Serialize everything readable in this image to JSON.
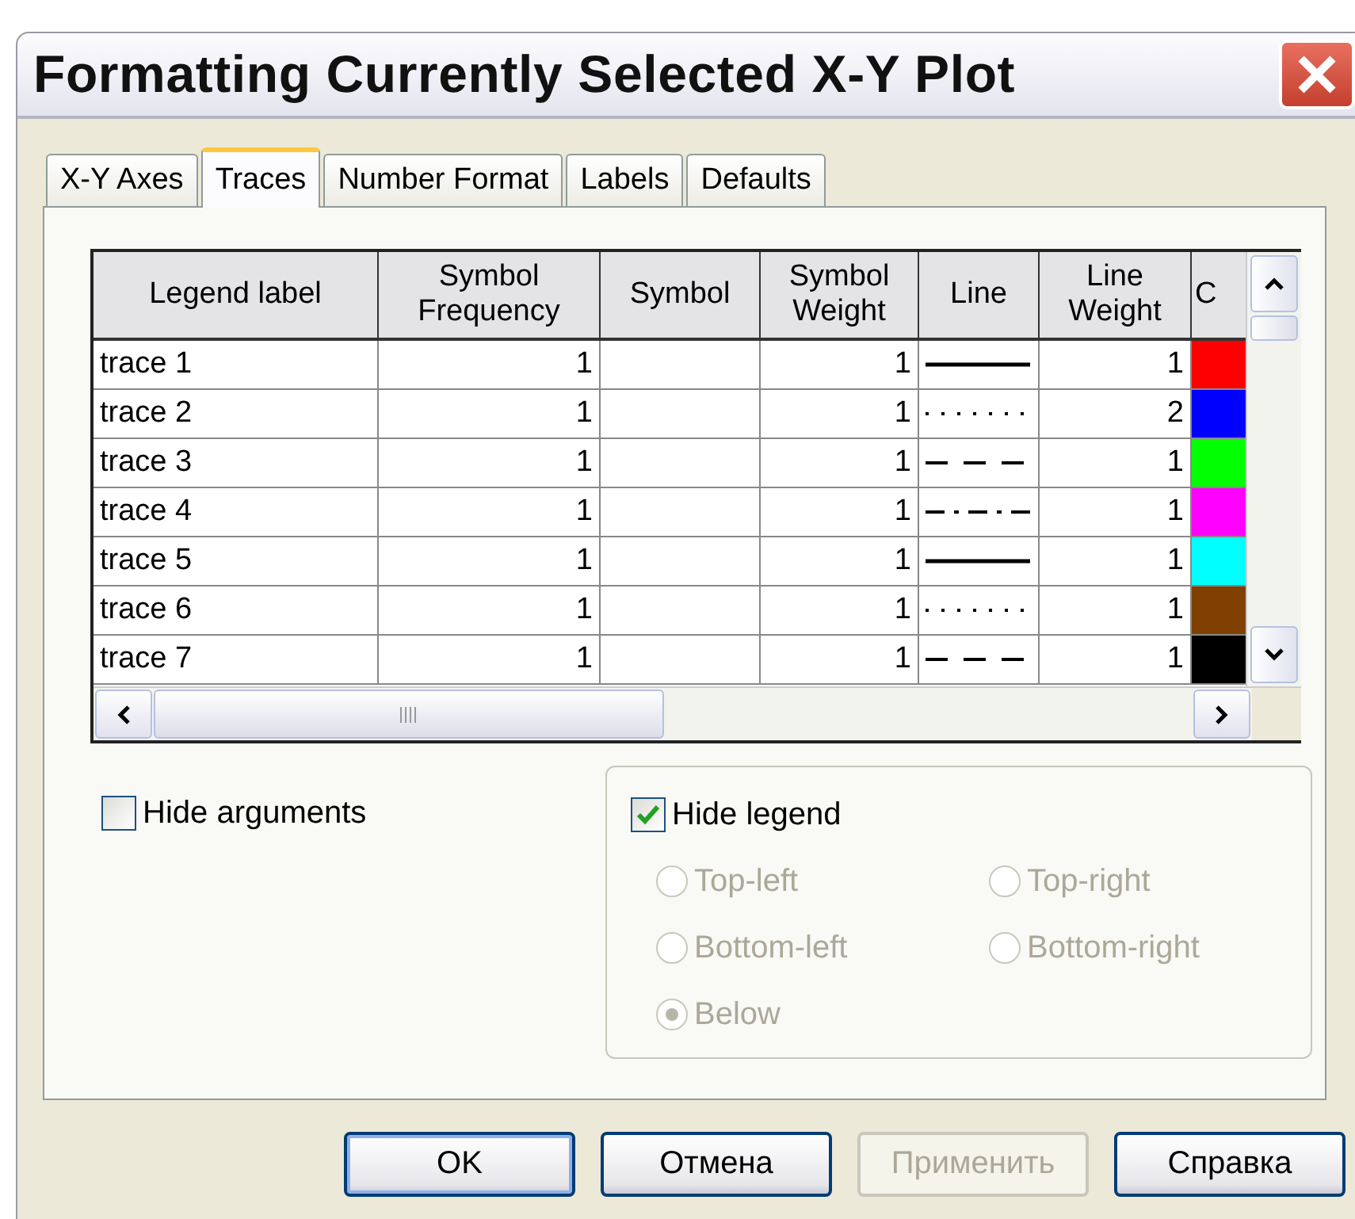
{
  "window": {
    "title": "Formatting Currently Selected X-Y Plot"
  },
  "tabs": [
    {
      "label": "X-Y Axes",
      "selected": false
    },
    {
      "label": "Traces",
      "selected": true
    },
    {
      "label": "Number Format",
      "selected": false
    },
    {
      "label": "Labels",
      "selected": false
    },
    {
      "label": "Defaults",
      "selected": false
    }
  ],
  "table": {
    "columns": [
      "Legend label",
      "Symbol Frequency",
      "Symbol",
      "Symbol Weight",
      "Line",
      "Line Weight",
      "C"
    ],
    "rows": [
      {
        "legend_label": "trace 1",
        "symbol_frequency": "1",
        "symbol_weight": "1",
        "line": {
          "kind": "solid"
        },
        "line_weight": "1",
        "color": "#ff0000"
      },
      {
        "legend_label": "trace 2",
        "symbol_frequency": "1",
        "symbol_weight": "1",
        "line": {
          "kind": "dotted"
        },
        "line_weight": "2",
        "color": "#0000ff"
      },
      {
        "legend_label": "trace 3",
        "symbol_frequency": "1",
        "symbol_weight": "1",
        "line": {
          "kind": "dashed"
        },
        "line_weight": "1",
        "color": "#00ff00"
      },
      {
        "legend_label": "trace 4",
        "symbol_frequency": "1",
        "symbol_weight": "1",
        "line": {
          "kind": "dashdot"
        },
        "line_weight": "1",
        "color": "#ff00ff"
      },
      {
        "legend_label": "trace 5",
        "symbol_frequency": "1",
        "symbol_weight": "1",
        "line": {
          "kind": "solid"
        },
        "line_weight": "1",
        "color": "#00ffff"
      },
      {
        "legend_label": "trace 6",
        "symbol_frequency": "1",
        "symbol_weight": "1",
        "line": {
          "kind": "dotted"
        },
        "line_weight": "1",
        "color": "#804000"
      },
      {
        "legend_label": "trace 7",
        "symbol_frequency": "1",
        "symbol_weight": "1",
        "line": {
          "kind": "dashed"
        },
        "line_weight": "1",
        "color": "#000000"
      }
    ]
  },
  "hide_arguments": {
    "label": "Hide arguments",
    "checked": false
  },
  "hide_legend": {
    "label": "Hide legend",
    "checked": true
  },
  "legend_positions": [
    {
      "label": "Top-left",
      "selected": false
    },
    {
      "label": "Top-right",
      "selected": false
    },
    {
      "label": "Bottom-left",
      "selected": false
    },
    {
      "label": "Bottom-right",
      "selected": false
    },
    {
      "label": "Below",
      "selected": true
    }
  ],
  "buttons": [
    {
      "label": "OK",
      "disabled": false,
      "default": true
    },
    {
      "label": "Отмена",
      "disabled": false,
      "default": false
    },
    {
      "label": "Применить",
      "disabled": true,
      "default": false
    },
    {
      "label": "Справка",
      "disabled": false,
      "default": false
    }
  ]
}
